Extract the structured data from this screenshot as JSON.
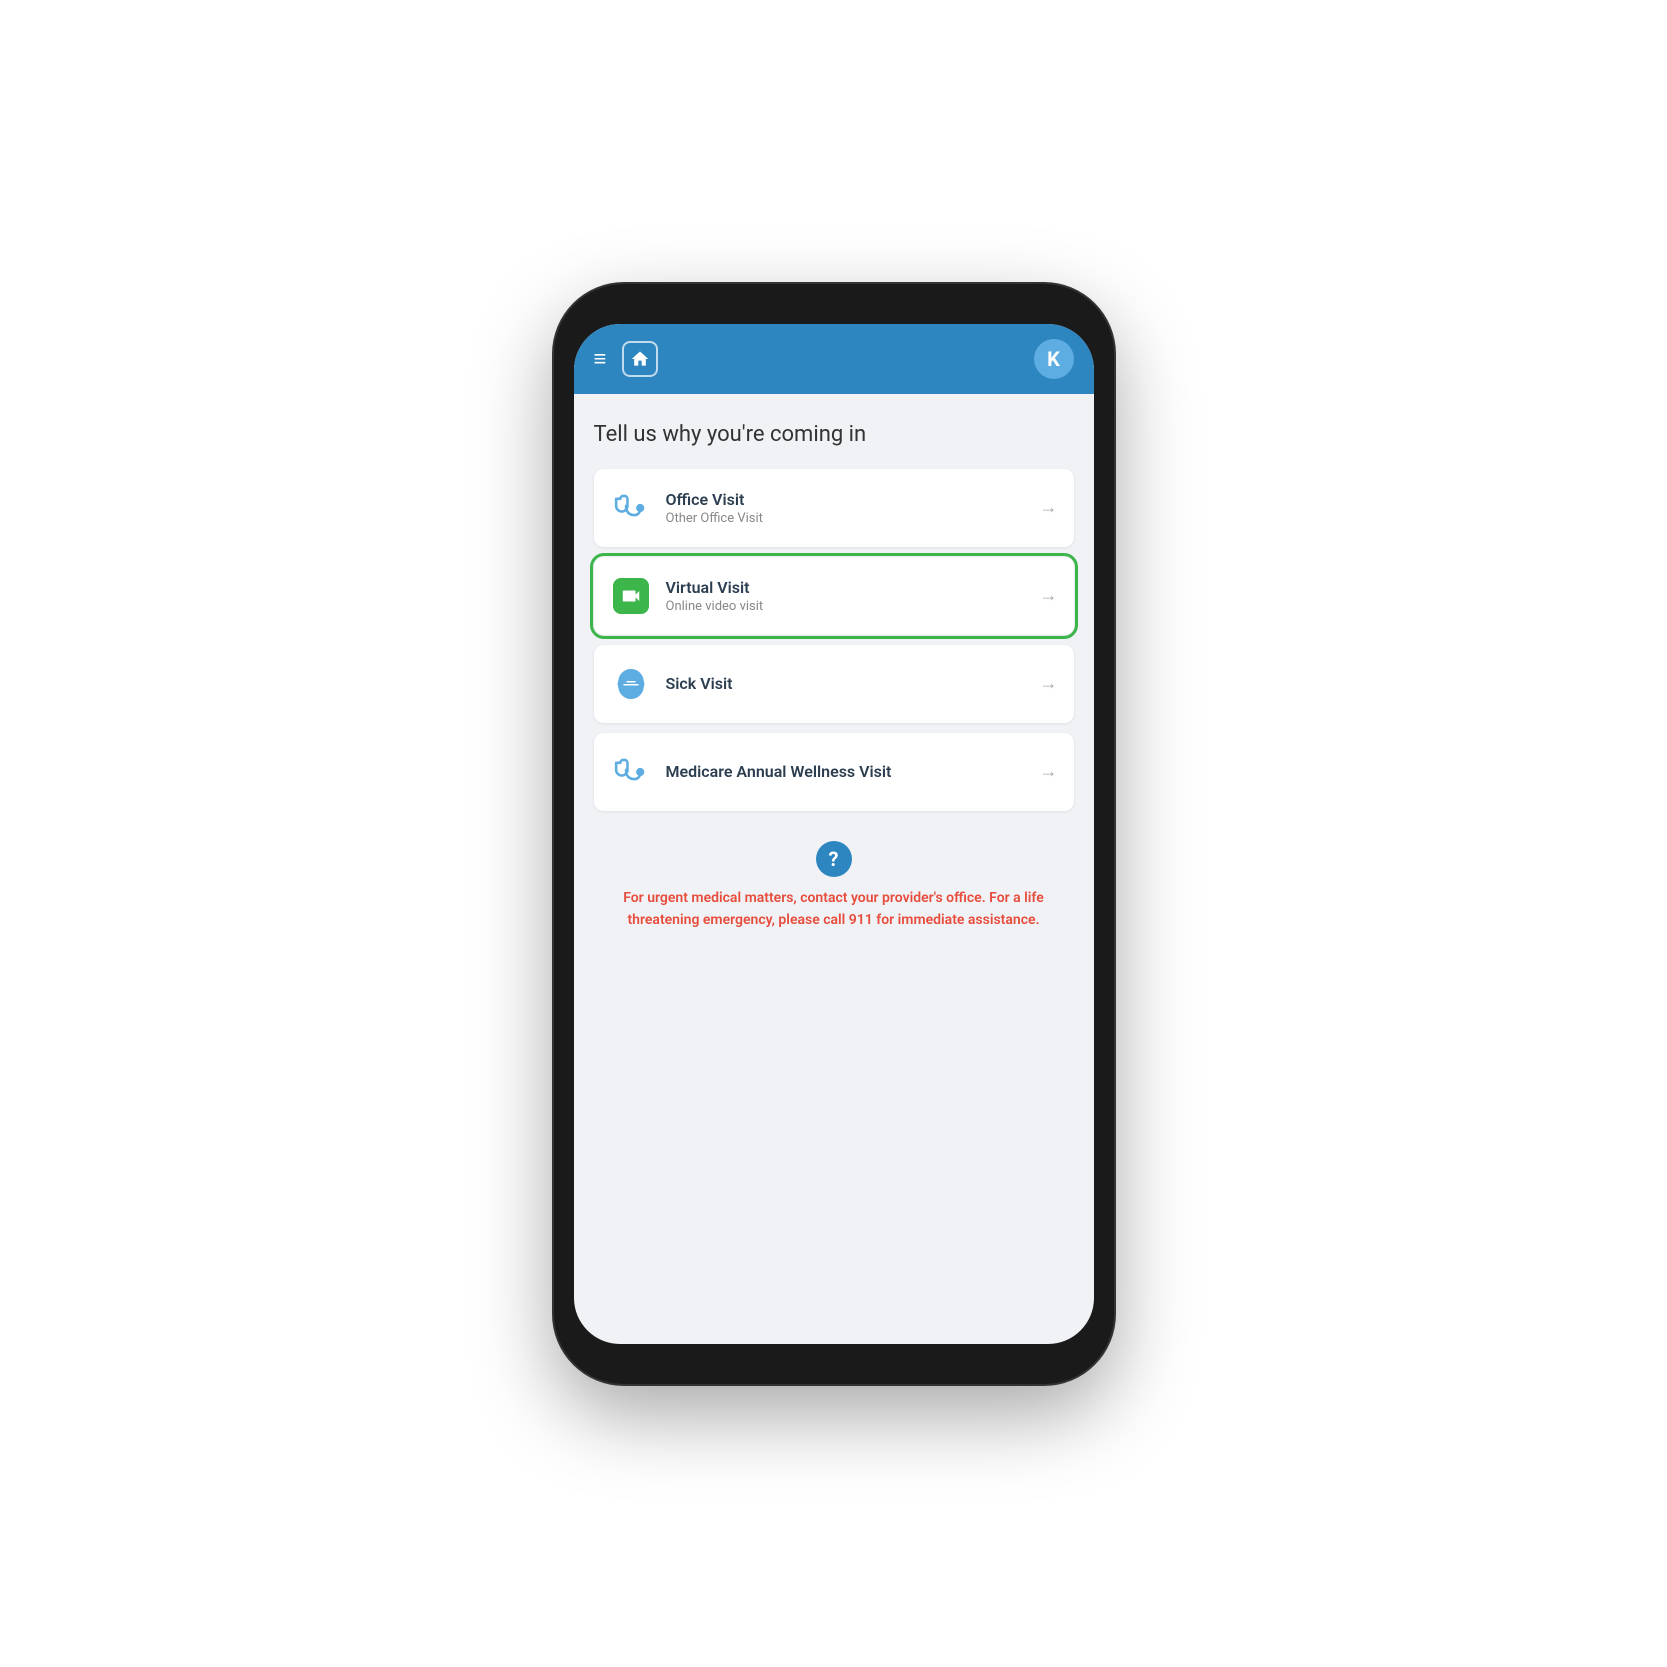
{
  "header": {
    "menu_icon": "≡",
    "k_label": "K",
    "brand_color": "#2e86c1"
  },
  "page": {
    "title": "Tell us why you're coming in"
  },
  "visit_options": [
    {
      "id": "office-visit",
      "title": "Office Visit",
      "subtitle": "Other Office Visit",
      "icon_type": "stethoscope",
      "highlighted": false
    },
    {
      "id": "virtual-visit",
      "title": "Virtual Visit",
      "subtitle": "Online video visit",
      "icon_type": "video-chat",
      "highlighted": true
    },
    {
      "id": "sick-visit",
      "title": "Sick Visit",
      "subtitle": "",
      "icon_type": "mask",
      "highlighted": false
    },
    {
      "id": "medicare-visit",
      "title": "Medicare Annual Wellness Visit",
      "subtitle": "",
      "icon_type": "stethoscope",
      "highlighted": false
    }
  ],
  "emergency": {
    "question_mark": "?",
    "message": "For urgent medical matters, contact your provider's office. For a life threatening emergency, please call 911 for immediate assistance."
  },
  "chevron": "→"
}
